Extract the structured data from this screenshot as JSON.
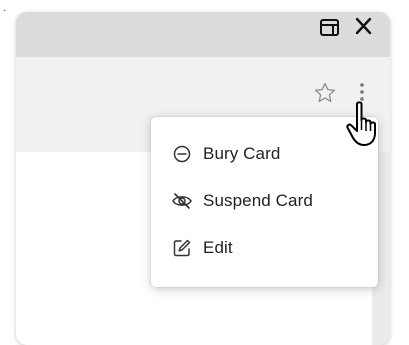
{
  "window": {
    "toolbar": {
      "icons": [
        "panel-icon",
        "close-icon",
        "star-icon",
        "more-vertical-icon"
      ]
    }
  },
  "context_menu": {
    "items": [
      {
        "label": "Bury Card",
        "icon": "minus-circle-icon"
      },
      {
        "label": "Suspend Card",
        "icon": "eye-off-icon"
      },
      {
        "label": "Edit",
        "icon": "edit-icon"
      }
    ]
  },
  "cursor": {
    "icon": "hand-pointer-icon"
  },
  "colors": {
    "titlebar": "#dcdcdc",
    "window_bg": "#f1f1f3",
    "menu_bg": "#ffffff",
    "text": "#222222",
    "icon": "#333333"
  }
}
